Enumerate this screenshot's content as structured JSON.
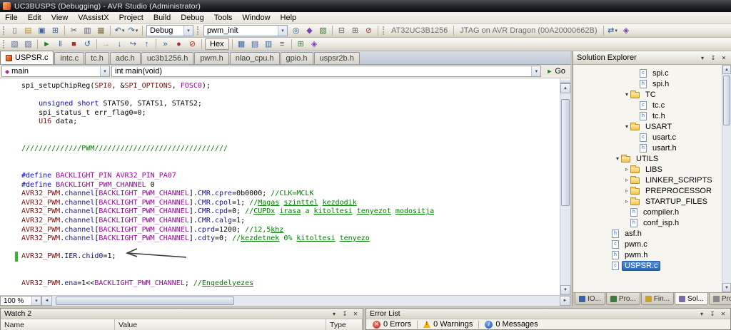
{
  "window": {
    "title": "UC3BUSPS (Debugging) - AVR Studio (Administrator)"
  },
  "menu": {
    "items": [
      "File",
      "Edit",
      "View",
      "VAssistX",
      "Project",
      "Build",
      "Debug",
      "Tools",
      "Window",
      "Help"
    ]
  },
  "toolbar_row1": [
    {
      "t": "grip"
    },
    {
      "t": "icon",
      "n": "new-file-button",
      "g": "▯",
      "c": "#55606e"
    },
    {
      "t": "icon",
      "n": "open-file-button",
      "g": "▤",
      "c": "#b8912f"
    },
    {
      "t": "icon",
      "n": "save-button",
      "g": "▣",
      "c": "#3a62a8"
    },
    {
      "t": "icon",
      "n": "save-all-button",
      "g": "⊞",
      "c": "#3a62a8"
    },
    {
      "t": "sep"
    },
    {
      "t": "icon",
      "n": "cut-button",
      "g": "✂",
      "c": "#555555"
    },
    {
      "t": "icon",
      "n": "copy-button",
      "g": "▥",
      "c": "#556077"
    },
    {
      "t": "icon",
      "n": "paste-button",
      "g": "▦",
      "c": "#85713d"
    },
    {
      "t": "sep"
    },
    {
      "t": "icon",
      "n": "undo-button",
      "g": "↶",
      "c": "#2c5aa0",
      "drop": true
    },
    {
      "t": "icon",
      "n": "redo-button",
      "g": "↷",
      "c": "#2c5aa0",
      "drop": true
    },
    {
      "t": "sep"
    },
    {
      "t": "combo",
      "n": "configuration-combo",
      "v": "Debug",
      "w": 66
    },
    {
      "t": "grip"
    },
    {
      "t": "combo",
      "n": "va-symbol-combo",
      "v": "pwm_init",
      "w": 118
    },
    {
      "t": "icon",
      "n": "find-symbol-button",
      "g": "◎",
      "c": "#2c5aa0"
    },
    {
      "t": "icon",
      "n": "goto-definition-button",
      "g": "◆",
      "c": "#7a3fb0"
    },
    {
      "t": "icon",
      "n": "find-references-button",
      "g": "▧",
      "c": "#3a7a3a"
    },
    {
      "t": "sep"
    },
    {
      "t": "icon",
      "n": "build-button",
      "g": "⊟",
      "c": "#666666"
    },
    {
      "t": "icon",
      "n": "rebuild-button",
      "g": "⊞",
      "c": "#666666"
    },
    {
      "t": "icon",
      "n": "cancel-build-button",
      "g": "⊘",
      "c": "#a33a2e"
    },
    {
      "t": "sep"
    },
    {
      "t": "grip"
    },
    {
      "t": "label",
      "n": "device-label",
      "v": "AT32UC3B1256"
    },
    {
      "t": "sep"
    },
    {
      "t": "label",
      "n": "programmer-label",
      "v": "JTAG on AVR Dragon (00A20000662B)"
    },
    {
      "t": "sep"
    },
    {
      "t": "icon",
      "n": "connect-button",
      "g": "⇄",
      "c": "#2c5aa0",
      "drop": true
    },
    {
      "t": "icon",
      "n": "device-programming-button",
      "g": "◈",
      "c": "#7a3fb0"
    }
  ],
  "toolbar_row2": [
    {
      "t": "grip"
    },
    {
      "t": "icon",
      "n": "bookmark-button",
      "g": "▧",
      "c": "#566a8e"
    },
    {
      "t": "icon",
      "n": "comment-button",
      "g": "▨",
      "c": "#566a8e"
    },
    {
      "t": "sep"
    },
    {
      "t": "icon",
      "n": "continue-button",
      "g": "►",
      "c": "#1e7d1e"
    },
    {
      "t": "icon",
      "n": "break-all-button",
      "g": "‖",
      "c": "#2c5aa0"
    },
    {
      "t": "icon",
      "n": "stop-debugging-button",
      "g": "■",
      "c": "#b03030"
    },
    {
      "t": "icon",
      "n": "restart-button",
      "g": "↺",
      "c": "#2c5aa0"
    },
    {
      "t": "sep"
    },
    {
      "t": "icon",
      "n": "show-next-statement-button",
      "g": "→",
      "c": "#c9a227"
    },
    {
      "t": "icon",
      "n": "step-into-button",
      "g": "↓",
      "c": "#2c5aa0"
    },
    {
      "t": "icon",
      "n": "step-over-button",
      "g": "↪",
      "c": "#2c5aa0"
    },
    {
      "t": "icon",
      "n": "step-out-button",
      "g": "↑",
      "c": "#2c5aa0"
    },
    {
      "t": "sep"
    },
    {
      "t": "icon",
      "n": "run-to-cursor-button",
      "g": "»",
      "c": "#2c5aa0"
    },
    {
      "t": "icon",
      "n": "toggle-breakpoint-button",
      "g": "●",
      "c": "#a03030"
    },
    {
      "t": "icon",
      "n": "clear-breakpoints-button",
      "g": "⊘",
      "c": "#a03030"
    },
    {
      "t": "sep"
    },
    {
      "t": "toggle",
      "n": "hex-toggle",
      "v": "Hex"
    },
    {
      "t": "sep"
    },
    {
      "t": "icon",
      "n": "watch-window-button",
      "g": "▦",
      "c": "#3a62a8"
    },
    {
      "t": "icon",
      "n": "memory-window-button",
      "g": "▤",
      "c": "#3a62a8"
    },
    {
      "t": "icon",
      "n": "register-window-button",
      "g": "▥",
      "c": "#3a62a8"
    },
    {
      "t": "icon",
      "n": "disassembly-window-button",
      "g": "≡",
      "c": "#3a62a8"
    },
    {
      "t": "sep"
    },
    {
      "t": "icon",
      "n": "io-view-button",
      "g": "⊞",
      "c": "#3a7a3a"
    },
    {
      "t": "icon",
      "n": "processor-view-button",
      "g": "◈",
      "c": "#7a3fb0"
    }
  ],
  "editor": {
    "tabs": [
      {
        "label": "USPSR.c",
        "active": true
      },
      {
        "label": "intc.c"
      },
      {
        "label": "tc.h"
      },
      {
        "label": "adc.h"
      },
      {
        "label": "uc3b1256.h"
      },
      {
        "label": "pwm.h"
      },
      {
        "label": "nlao_cpu.h"
      },
      {
        "label": "gpio.h"
      },
      {
        "label": "uspsr2b.h"
      }
    ],
    "navbar": {
      "scope": "main",
      "member": "int main(void)",
      "go_label": "Go"
    },
    "zoom": "100 %",
    "code": {
      "lines": [
        {
          "seg": [
            [
              "p",
              "spi_setupChipReg("
            ],
            [
              "t",
              "SPI0"
            ],
            [
              "p",
              ", &"
            ],
            [
              "t",
              "SPI_OPTIONS"
            ],
            [
              "p",
              ", "
            ],
            [
              "m",
              "FOSC0"
            ],
            [
              "p",
              ");"
            ]
          ]
        },
        {
          "seg": []
        },
        {
          "seg": [
            [
              "p",
              "    "
            ],
            [
              "k",
              "unsigned"
            ],
            [
              "p",
              " "
            ],
            [
              "k",
              "short"
            ],
            [
              "p",
              " STATS0, STATS1, STATS2;"
            ]
          ]
        },
        {
          "seg": [
            [
              "p",
              "    spi_status_t err_flag0=0;"
            ]
          ]
        },
        {
          "seg": [
            [
              "p",
              "    "
            ],
            [
              "t",
              "U16"
            ],
            [
              "p",
              " data;"
            ]
          ]
        },
        {
          "seg": []
        },
        {
          "seg": []
        },
        {
          "seg": [
            [
              "c",
              "//////////////PWM///////////////////////////////"
            ]
          ]
        },
        {
          "seg": []
        },
        {
          "seg": []
        },
        {
          "seg": [
            [
              "k",
              "#define"
            ],
            [
              "p",
              " "
            ],
            [
              "m",
              "BACKLIGHT_PIN"
            ],
            [
              "p",
              " "
            ],
            [
              "m",
              "AVR32_PIN_PA07"
            ]
          ]
        },
        {
          "seg": [
            [
              "k",
              "#define"
            ],
            [
              "p",
              " "
            ],
            [
              "m",
              "BACKLIGHT_PWM_CHANNEL"
            ],
            [
              "p",
              " 0"
            ]
          ]
        },
        {
          "seg": [
            [
              "t",
              "AVR32_PWM"
            ],
            [
              "p",
              "."
            ],
            [
              "b",
              "channel"
            ],
            [
              "p",
              "["
            ],
            [
              "m",
              "BACKLIGHT_PWM_CHANNEL"
            ],
            [
              "p",
              "]."
            ],
            [
              "b",
              "CMR"
            ],
            [
              "p",
              "."
            ],
            [
              "b",
              "cpre"
            ],
            [
              "p",
              "=0b0000; "
            ],
            [
              "c",
              "//CLK=MCLK"
            ]
          ]
        },
        {
          "seg": [
            [
              "t",
              "AVR32_PWM"
            ],
            [
              "p",
              "."
            ],
            [
              "b",
              "channel"
            ],
            [
              "p",
              "["
            ],
            [
              "m",
              "BACKLIGHT_PWM_CHANNEL"
            ],
            [
              "p",
              "]."
            ],
            [
              "b",
              "CMR"
            ],
            [
              "p",
              "."
            ],
            [
              "b",
              "cpol"
            ],
            [
              "p",
              "=1; "
            ],
            [
              "c",
              "//"
            ],
            [
              "cu",
              "Magas"
            ],
            [
              "c",
              " "
            ],
            [
              "cu",
              "szinttel"
            ],
            [
              "c",
              " "
            ],
            [
              "cu",
              "kezdodik"
            ]
          ]
        },
        {
          "seg": [
            [
              "t",
              "AVR32_PWM"
            ],
            [
              "p",
              "."
            ],
            [
              "b",
              "channel"
            ],
            [
              "p",
              "["
            ],
            [
              "m",
              "BACKLIGHT_PWM_CHANNEL"
            ],
            [
              "p",
              "]."
            ],
            [
              "b",
              "CMR"
            ],
            [
              "p",
              "."
            ],
            [
              "b",
              "cpd"
            ],
            [
              "p",
              "=0; "
            ],
            [
              "c",
              "//"
            ],
            [
              "cu",
              "CUPDx"
            ],
            [
              "c",
              " "
            ],
            [
              "cu",
              "irasa"
            ],
            [
              "c",
              " a "
            ],
            [
              "cu",
              "kitoltesi"
            ],
            [
              "c",
              " "
            ],
            [
              "cu",
              "tenyezot"
            ],
            [
              "c",
              " "
            ],
            [
              "cu",
              "modositja"
            ]
          ]
        },
        {
          "seg": [
            [
              "t",
              "AVR32_PWM"
            ],
            [
              "p",
              "."
            ],
            [
              "b",
              "channel"
            ],
            [
              "p",
              "["
            ],
            [
              "m",
              "BACKLIGHT_PWM_CHANNEL"
            ],
            [
              "p",
              "]."
            ],
            [
              "b",
              "CMR"
            ],
            [
              "p",
              "."
            ],
            [
              "b",
              "calg"
            ],
            [
              "p",
              "=1;"
            ]
          ]
        },
        {
          "seg": [
            [
              "t",
              "AVR32_PWM"
            ],
            [
              "p",
              "."
            ],
            [
              "b",
              "channel"
            ],
            [
              "p",
              "["
            ],
            [
              "m",
              "BACKLIGHT_PWM_CHANNEL"
            ],
            [
              "p",
              "]."
            ],
            [
              "b",
              "cprd"
            ],
            [
              "p",
              "=1200; "
            ],
            [
              "c",
              "//12,5"
            ],
            [
              "cu",
              "khz"
            ]
          ]
        },
        {
          "seg": [
            [
              "t",
              "AVR32_PWM"
            ],
            [
              "p",
              "."
            ],
            [
              "b",
              "channel"
            ],
            [
              "p",
              "["
            ],
            [
              "m",
              "BACKLIGHT_PWM_CHANNEL"
            ],
            [
              "p",
              "]."
            ],
            [
              "b",
              "cdty"
            ],
            [
              "p",
              "=0; "
            ],
            [
              "c",
              "//"
            ],
            [
              "cu",
              "kezdetnek"
            ],
            [
              "c",
              " 0% "
            ],
            [
              "cu",
              "kitoltesi"
            ],
            [
              "c",
              " "
            ],
            [
              "cu",
              "tenyezo"
            ]
          ]
        },
        {
          "seg": []
        },
        {
          "seg": [
            [
              "t",
              "AVR32_PWM"
            ],
            [
              "p",
              "."
            ],
            [
              "b",
              "IER"
            ],
            [
              "p",
              "."
            ],
            [
              "b",
              "chid0"
            ],
            [
              "p",
              "=1;"
            ]
          ],
          "mark": true
        },
        {
          "seg": []
        },
        {
          "seg": []
        },
        {
          "seg": [
            [
              "t",
              "AVR32_PWM"
            ],
            [
              "p",
              "."
            ],
            [
              "b",
              "ena"
            ],
            [
              "p",
              "=1<<"
            ],
            [
              "m",
              "BACKLIGHT_PWM_CHANNEL"
            ],
            [
              "p",
              "; "
            ],
            [
              "c",
              "//"
            ],
            [
              "cu",
              "Engedelyezes"
            ]
          ]
        }
      ]
    }
  },
  "solution_explorer": {
    "title": "Solution Explorer",
    "items": [
      {
        "label": "spi.c",
        "icon": "c",
        "lvl": 3
      },
      {
        "label": "spi.h",
        "icon": "h",
        "lvl": 3
      },
      {
        "label": "TC",
        "icon": "folder",
        "lvl": 2,
        "exp": true
      },
      {
        "label": "tc.c",
        "icon": "c",
        "lvl": 3
      },
      {
        "label": "tc.h",
        "icon": "h",
        "lvl": 3
      },
      {
        "label": "USART",
        "icon": "folder",
        "lvl": 2,
        "exp": true
      },
      {
        "label": "usart.c",
        "icon": "c",
        "lvl": 3
      },
      {
        "label": "usart.h",
        "icon": "h",
        "lvl": 3
      },
      {
        "label": "UTILS",
        "icon": "folder",
        "lvl": 1,
        "exp": true
      },
      {
        "label": "LIBS",
        "icon": "folder",
        "lvl": 2,
        "exp": false
      },
      {
        "label": "LINKER_SCRIPTS",
        "icon": "folder",
        "lvl": 2,
        "exp": false
      },
      {
        "label": "PREPROCESSOR",
        "icon": "folder",
        "lvl": 2,
        "exp": false
      },
      {
        "label": "STARTUP_FILES",
        "icon": "folder",
        "lvl": 2,
        "exp": false
      },
      {
        "label": "compiler.h",
        "icon": "h",
        "lvl": 2
      },
      {
        "label": "conf_isp.h",
        "icon": "h",
        "lvl": 2
      },
      {
        "label": "asf.h",
        "icon": "h",
        "lvl": 0
      },
      {
        "label": "pwm.c",
        "icon": "c",
        "lvl": 0
      },
      {
        "label": "pwm.h",
        "icon": "h",
        "lvl": 0
      },
      {
        "label": "USPSR.c",
        "icon": "c",
        "lvl": 0,
        "selected": true
      }
    ]
  },
  "panel_tabs": [
    {
      "label": "IO..."
    },
    {
      "label": "Pro..."
    },
    {
      "label": "Fin..."
    },
    {
      "label": "Sol...",
      "active": true
    },
    {
      "label": "Pro"
    }
  ],
  "watch": {
    "title": "Watch 2",
    "columns": [
      "Name",
      "Value",
      "Type"
    ]
  },
  "error_list": {
    "title": "Error List",
    "errors_label": "0 Errors",
    "warnings_label": "0 Warnings",
    "messages_label": "0 Messages"
  }
}
